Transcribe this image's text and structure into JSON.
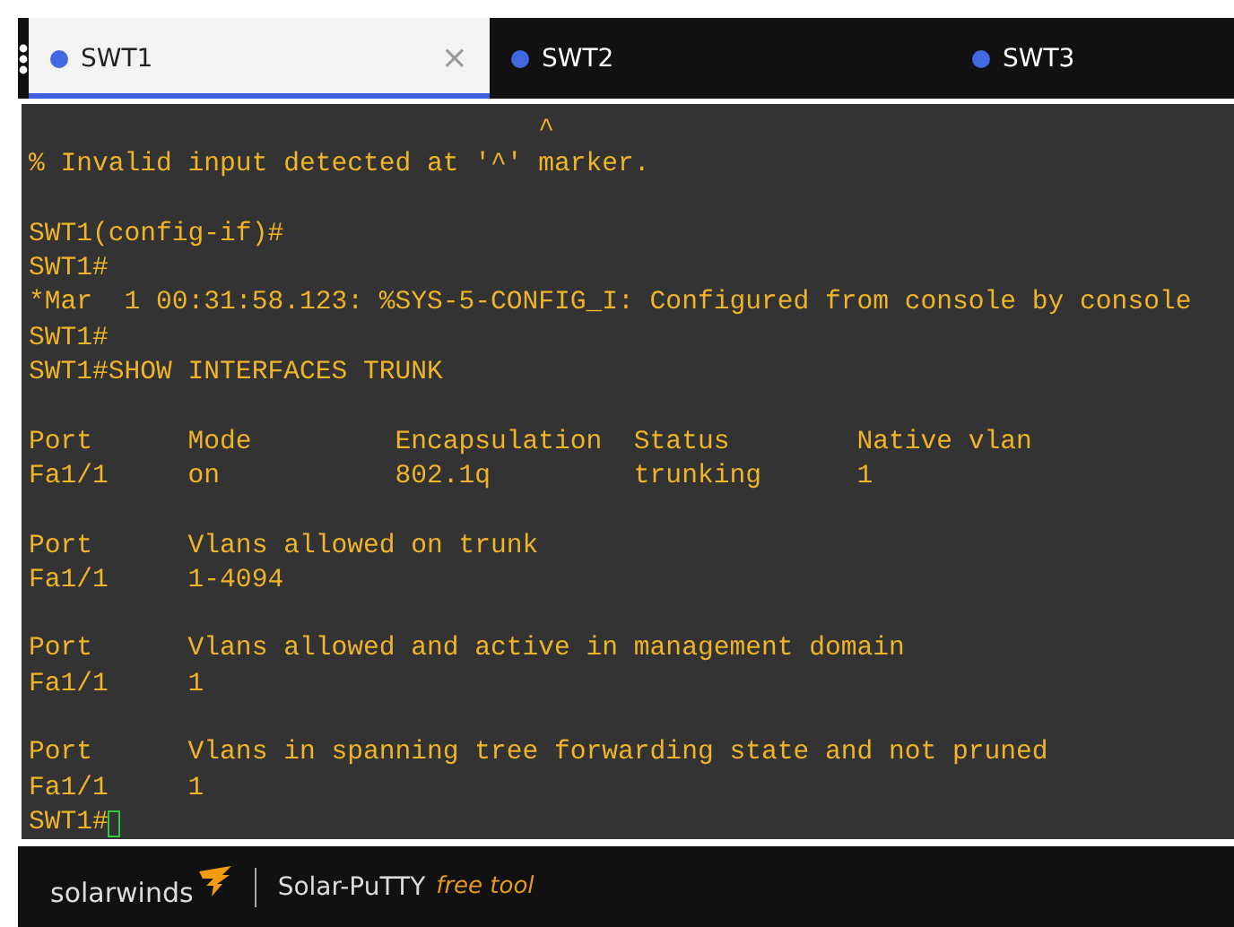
{
  "tabs": [
    {
      "label": "SWT1",
      "selected": true,
      "close": "×"
    },
    {
      "label": "SWT2",
      "selected": false
    },
    {
      "label": "SWT3",
      "selected": false
    }
  ],
  "terminal": {
    "blocks": [
      [
        "                                ^",
        "% Invalid input detected at '^' marker."
      ],
      [
        "SWT1(config-if)#",
        "SWT1#",
        "*Mar  1 00:31:58.123: %SYS-5-CONFIG_I: Configured from console by console",
        "SWT1#",
        "SWT1#SHOW INTERFACES TRUNK"
      ],
      [
        "Port      Mode         Encapsulation  Status        Native vlan",
        "Fa1/1     on           802.1q         trunking      1"
      ],
      [
        "Port      Vlans allowed on trunk",
        "Fa1/1     1-4094"
      ],
      [
        "Port      Vlans allowed and active in management domain",
        "Fa1/1     1"
      ],
      [
        "Port      Vlans in spanning tree forwarding state and not pruned",
        "Fa1/1     1"
      ]
    ],
    "prompt": "SWT1#"
  },
  "footer": {
    "brand": "solarwinds",
    "product": "Solar-PuTTY",
    "edition": "free tool"
  }
}
